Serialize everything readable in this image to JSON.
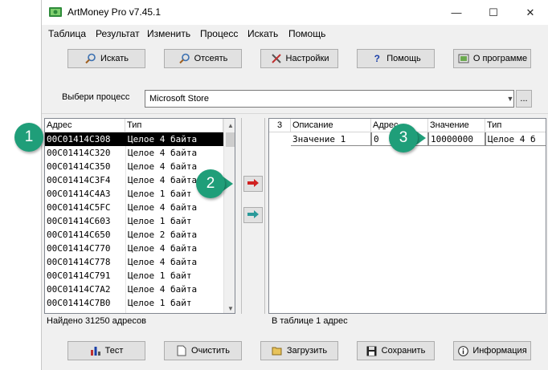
{
  "window": {
    "title": "ArtMoney Pro v7.45.1"
  },
  "menu": [
    "Таблица",
    "Результат",
    "Изменить",
    "Процесс",
    "Искать",
    "Помощь"
  ],
  "toolbar": {
    "search": "Искать",
    "filter": "Отсеять",
    "settings": "Настройки",
    "help": "Помощь",
    "about": "О программе"
  },
  "process": {
    "label": "Выбери процесс",
    "selected": "Microsoft Store",
    "browse": "..."
  },
  "left_table": {
    "columns": [
      "Адрес",
      "Тип"
    ],
    "rows": [
      {
        "addr": "00C01414C308",
        "type": "Целое 4 байта"
      },
      {
        "addr": "00C01414C320",
        "type": "Целое 4 байта"
      },
      {
        "addr": "00C01414C350",
        "type": "Целое 4 байта"
      },
      {
        "addr": "00C01414C3F4",
        "type": "Целое 4 байта"
      },
      {
        "addr": "00C01414C4A3",
        "type": "Целое 1 байт"
      },
      {
        "addr": "00C01414C5FC",
        "type": "Целое 4 байта"
      },
      {
        "addr": "00C01414C603",
        "type": "Целое 1 байт"
      },
      {
        "addr": "00C01414C650",
        "type": "Целое 2 байта"
      },
      {
        "addr": "00C01414C770",
        "type": "Целое 4 байта"
      },
      {
        "addr": "00C01414C778",
        "type": "Целое 4 байта"
      },
      {
        "addr": "00C01414C791",
        "type": "Целое 1 байт"
      },
      {
        "addr": "00C01414C7A2",
        "type": "Целое 4 байта"
      },
      {
        "addr": "00C01414C7B0",
        "type": "Целое 1 байт"
      }
    ],
    "status": "Найдено 31250 адресов"
  },
  "right_table": {
    "columns": [
      "3",
      "Описание",
      "Адрес",
      "Значение",
      "Тип"
    ],
    "row": {
      "description": "Значение 1",
      "address": "0",
      "value": "10000000",
      "type": "Целое 4 б"
    },
    "status": "В таблице 1 адрес"
  },
  "badges": [
    "1",
    "2",
    "3"
  ],
  "bottom": {
    "test": "Тест",
    "clear": "Очистить",
    "load": "Загрузить",
    "save": "Сохранить",
    "info": "Информация"
  },
  "colors": {
    "badge": "#1f9e79",
    "selection": "#000000",
    "arrow_red": "#d02020",
    "arrow_teal": "#2a9a9a"
  }
}
